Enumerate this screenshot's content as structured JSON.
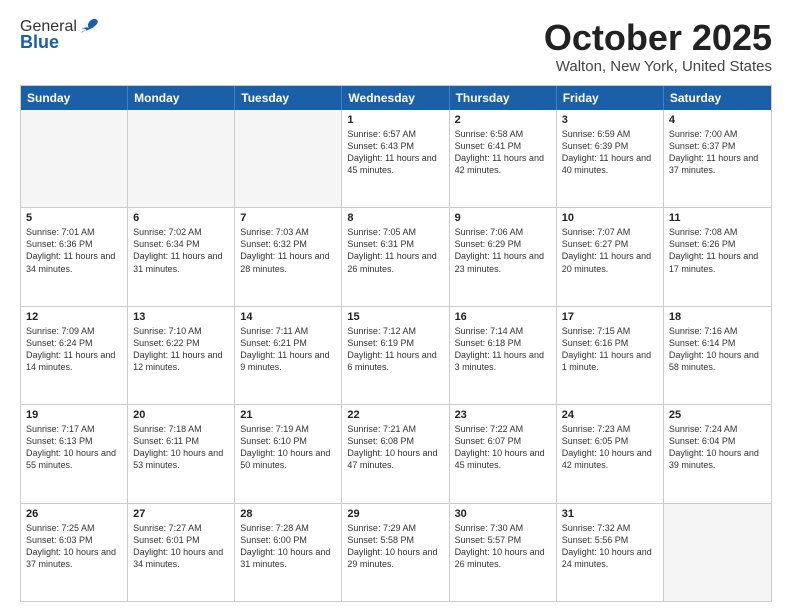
{
  "header": {
    "logo_general": "General",
    "logo_blue": "Blue",
    "month_title": "October 2025",
    "location": "Walton, New York, United States"
  },
  "days_of_week": [
    "Sunday",
    "Monday",
    "Tuesday",
    "Wednesday",
    "Thursday",
    "Friday",
    "Saturday"
  ],
  "weeks": [
    [
      {
        "date": "",
        "empty": true
      },
      {
        "date": "",
        "empty": true
      },
      {
        "date": "",
        "empty": true
      },
      {
        "date": "1",
        "sunrise": "6:57 AM",
        "sunset": "6:43 PM",
        "daylight": "11 hours and 45 minutes."
      },
      {
        "date": "2",
        "sunrise": "6:58 AM",
        "sunset": "6:41 PM",
        "daylight": "11 hours and 42 minutes."
      },
      {
        "date": "3",
        "sunrise": "6:59 AM",
        "sunset": "6:39 PM",
        "daylight": "11 hours and 40 minutes."
      },
      {
        "date": "4",
        "sunrise": "7:00 AM",
        "sunset": "6:37 PM",
        "daylight": "11 hours and 37 minutes."
      }
    ],
    [
      {
        "date": "5",
        "sunrise": "7:01 AM",
        "sunset": "6:36 PM",
        "daylight": "11 hours and 34 minutes."
      },
      {
        "date": "6",
        "sunrise": "7:02 AM",
        "sunset": "6:34 PM",
        "daylight": "11 hours and 31 minutes."
      },
      {
        "date": "7",
        "sunrise": "7:03 AM",
        "sunset": "6:32 PM",
        "daylight": "11 hours and 28 minutes."
      },
      {
        "date": "8",
        "sunrise": "7:05 AM",
        "sunset": "6:31 PM",
        "daylight": "11 hours and 26 minutes."
      },
      {
        "date": "9",
        "sunrise": "7:06 AM",
        "sunset": "6:29 PM",
        "daylight": "11 hours and 23 minutes."
      },
      {
        "date": "10",
        "sunrise": "7:07 AM",
        "sunset": "6:27 PM",
        "daylight": "11 hours and 20 minutes."
      },
      {
        "date": "11",
        "sunrise": "7:08 AM",
        "sunset": "6:26 PM",
        "daylight": "11 hours and 17 minutes."
      }
    ],
    [
      {
        "date": "12",
        "sunrise": "7:09 AM",
        "sunset": "6:24 PM",
        "daylight": "11 hours and 14 minutes."
      },
      {
        "date": "13",
        "sunrise": "7:10 AM",
        "sunset": "6:22 PM",
        "daylight": "11 hours and 12 minutes."
      },
      {
        "date": "14",
        "sunrise": "7:11 AM",
        "sunset": "6:21 PM",
        "daylight": "11 hours and 9 minutes."
      },
      {
        "date": "15",
        "sunrise": "7:12 AM",
        "sunset": "6:19 PM",
        "daylight": "11 hours and 6 minutes."
      },
      {
        "date": "16",
        "sunrise": "7:14 AM",
        "sunset": "6:18 PM",
        "daylight": "11 hours and 3 minutes."
      },
      {
        "date": "17",
        "sunrise": "7:15 AM",
        "sunset": "6:16 PM",
        "daylight": "11 hours and 1 minute."
      },
      {
        "date": "18",
        "sunrise": "7:16 AM",
        "sunset": "6:14 PM",
        "daylight": "10 hours and 58 minutes."
      }
    ],
    [
      {
        "date": "19",
        "sunrise": "7:17 AM",
        "sunset": "6:13 PM",
        "daylight": "10 hours and 55 minutes."
      },
      {
        "date": "20",
        "sunrise": "7:18 AM",
        "sunset": "6:11 PM",
        "daylight": "10 hours and 53 minutes."
      },
      {
        "date": "21",
        "sunrise": "7:19 AM",
        "sunset": "6:10 PM",
        "daylight": "10 hours and 50 minutes."
      },
      {
        "date": "22",
        "sunrise": "7:21 AM",
        "sunset": "6:08 PM",
        "daylight": "10 hours and 47 minutes."
      },
      {
        "date": "23",
        "sunrise": "7:22 AM",
        "sunset": "6:07 PM",
        "daylight": "10 hours and 45 minutes."
      },
      {
        "date": "24",
        "sunrise": "7:23 AM",
        "sunset": "6:05 PM",
        "daylight": "10 hours and 42 minutes."
      },
      {
        "date": "25",
        "sunrise": "7:24 AM",
        "sunset": "6:04 PM",
        "daylight": "10 hours and 39 minutes."
      }
    ],
    [
      {
        "date": "26",
        "sunrise": "7:25 AM",
        "sunset": "6:03 PM",
        "daylight": "10 hours and 37 minutes."
      },
      {
        "date": "27",
        "sunrise": "7:27 AM",
        "sunset": "6:01 PM",
        "daylight": "10 hours and 34 minutes."
      },
      {
        "date": "28",
        "sunrise": "7:28 AM",
        "sunset": "6:00 PM",
        "daylight": "10 hours and 31 minutes."
      },
      {
        "date": "29",
        "sunrise": "7:29 AM",
        "sunset": "5:58 PM",
        "daylight": "10 hours and 29 minutes."
      },
      {
        "date": "30",
        "sunrise": "7:30 AM",
        "sunset": "5:57 PM",
        "daylight": "10 hours and 26 minutes."
      },
      {
        "date": "31",
        "sunrise": "7:32 AM",
        "sunset": "5:56 PM",
        "daylight": "10 hours and 24 minutes."
      },
      {
        "date": "",
        "empty": true
      }
    ]
  ],
  "labels": {
    "sunrise": "Sunrise:",
    "sunset": "Sunset:",
    "daylight": "Daylight:"
  }
}
